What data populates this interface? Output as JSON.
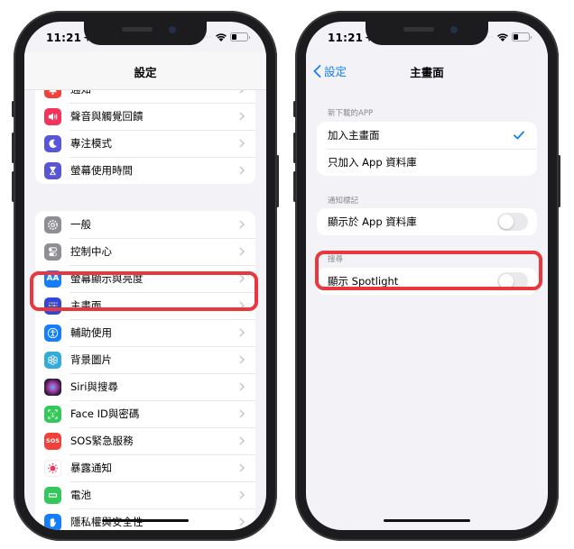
{
  "left_phone": {
    "status_bar": {
      "time": "11:21"
    },
    "nav": {
      "title": "設定"
    },
    "groups": [
      {
        "items": [
          {
            "label": "通知",
            "icon": "bell-icon",
            "color": "#f2413a"
          },
          {
            "label": "聲音與觸覺回饋",
            "icon": "speaker-icon",
            "color": "#f2345a"
          },
          {
            "label": "專注模式",
            "icon": "moon-icon",
            "color": "#5856d6"
          },
          {
            "label": "螢幕使用時間",
            "icon": "hourglass-icon",
            "color": "#5856d6"
          }
        ]
      },
      {
        "items": [
          {
            "label": "一般",
            "icon": "gear-icon",
            "color": "#8e8e93"
          },
          {
            "label": "控制中心",
            "icon": "switches-icon",
            "color": "#8e8e93"
          },
          {
            "label": "螢幕顯示與亮度",
            "icon": "text-size-icon",
            "color": "#147efb"
          },
          {
            "label": "主畫面",
            "icon": "home-screen-icon",
            "color": "#2f48d6",
            "highlighted": true
          },
          {
            "label": "輔助使用",
            "icon": "accessibility-icon",
            "color": "#147efb"
          },
          {
            "label": "背景圖片",
            "icon": "wallpaper-icon",
            "color": "#35aadc"
          },
          {
            "label": "Siri與搜尋",
            "icon": "siri-icon",
            "color": "#222233"
          },
          {
            "label": "Face ID與密碼",
            "icon": "face-id-icon",
            "color": "#34c759"
          },
          {
            "label": "SOS緊急服務",
            "icon": "sos-icon",
            "color": "#f2413a",
            "icon_text": "SOS"
          },
          {
            "label": "暴露通知",
            "icon": "exposure-icon",
            "color": "#ffffff"
          },
          {
            "label": "電池",
            "icon": "battery-icon",
            "color": "#34c759"
          },
          {
            "label": "隱私權與安全性",
            "icon": "hand-icon",
            "color": "#147efb"
          }
        ]
      }
    ]
  },
  "right_phone": {
    "status_bar": {
      "time": "11:21"
    },
    "nav": {
      "back_label": "設定",
      "title": "主畫面"
    },
    "sections": [
      {
        "header": "新下載的APP",
        "rows": [
          {
            "label": "加入主畫面",
            "selected": true
          },
          {
            "label": "只加入 App 資料庫",
            "selected": false
          }
        ]
      },
      {
        "header": "通知標記",
        "rows": [
          {
            "label": "顯示於 App 資料庫",
            "toggle": false
          }
        ]
      },
      {
        "header": "搜尋",
        "rows": [
          {
            "label": "顯示 Spotlight",
            "toggle": false,
            "highlighted": true
          }
        ]
      }
    ]
  },
  "colors": {
    "accent": "#147efb",
    "highlight": "#e8383d",
    "background": "#f2f2f7"
  }
}
